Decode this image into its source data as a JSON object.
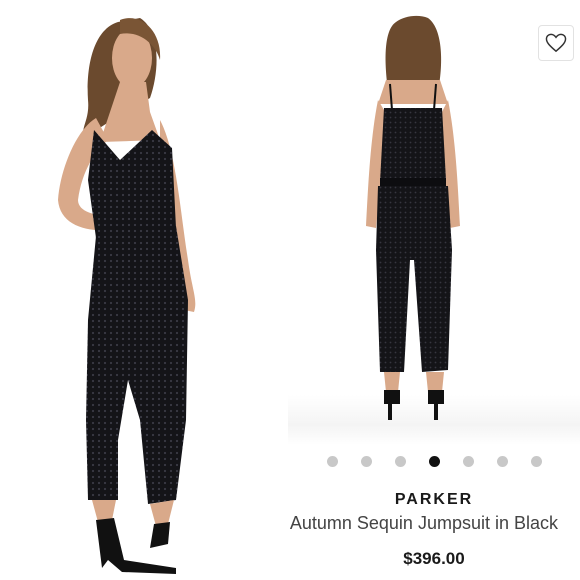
{
  "listing": {
    "brand": "PARKER",
    "product_name": "Autumn Sequin Jumpsuit in Black",
    "price": "$396.00",
    "favorite_icon": "heart-outline-icon",
    "carousel": {
      "total": 7,
      "active_index": 3
    }
  },
  "colors": {
    "garment": "#141418",
    "skin": "#d9a98a",
    "hair": "#6b4a2e",
    "active_dot": "#111111",
    "inactive_dot": "#c8c8c8"
  }
}
